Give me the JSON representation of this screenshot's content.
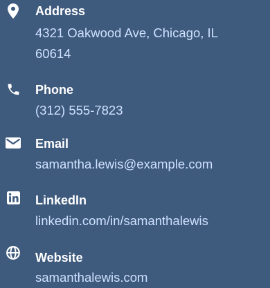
{
  "contact": {
    "address": {
      "icon": "map-pin-icon",
      "label": "Address",
      "line1": "4321 Oakwood Ave, Chicago, IL",
      "line2": "60614"
    },
    "phone": {
      "icon": "phone-icon",
      "label": "Phone",
      "value": "(312) 555-7823"
    },
    "email": {
      "icon": "envelope-icon",
      "label": "Email",
      "value": "samantha.lewis@example.com"
    },
    "linkedin": {
      "icon": "linkedin-icon",
      "label": "LinkedIn",
      "value": "linkedin.com/in/samanthalewis"
    },
    "website": {
      "icon": "globe-icon",
      "label": "Website",
      "value": "samanthalewis.com"
    }
  },
  "colors": {
    "background": "#3e5a7d",
    "label": "#ffffff",
    "value": "#cfe1ff"
  }
}
